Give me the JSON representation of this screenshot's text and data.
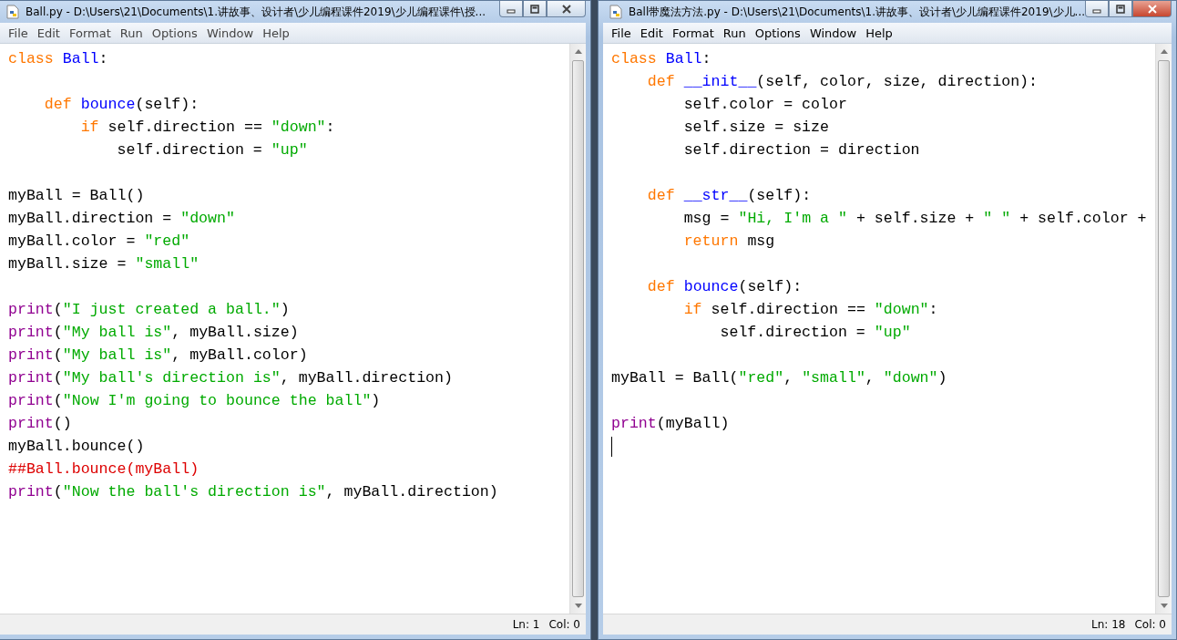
{
  "windows": [
    {
      "title": "Ball.py - D:\\Users\\21\\Documents\\1.讲故事、设计者\\少儿编程课件2019\\少儿编程课件\\授...",
      "active": false,
      "menu": [
        "File",
        "Edit",
        "Format",
        "Run",
        "Options",
        "Window",
        "Help"
      ],
      "lines": [
        {
          "kind": "code",
          "tokens": [
            {
              "kind": "keyword",
              "text": "class "
            },
            {
              "kind": "name",
              "text": "Ball"
            },
            {
              "kind": "plain",
              "text": ":"
            }
          ]
        },
        {
          "kind": "blank"
        },
        {
          "kind": "code",
          "tokens": [
            {
              "kind": "keyword",
              "text": "    def "
            },
            {
              "kind": "name",
              "text": "bounce"
            },
            {
              "kind": "plain",
              "text": "(self):"
            }
          ]
        },
        {
          "kind": "code",
          "tokens": [
            {
              "kind": "keyword",
              "text": "        if"
            },
            {
              "kind": "plain",
              "text": " self.direction == "
            },
            {
              "kind": "string",
              "text": "\"down\""
            },
            {
              "kind": "plain",
              "text": ":"
            }
          ]
        },
        {
          "kind": "code",
          "tokens": [
            {
              "kind": "plain",
              "text": "            self.direction = "
            },
            {
              "kind": "string",
              "text": "\"up\""
            }
          ]
        },
        {
          "kind": "blank"
        },
        {
          "kind": "code",
          "tokens": [
            {
              "kind": "plain",
              "text": "myBall = Ball()"
            }
          ]
        },
        {
          "kind": "code",
          "tokens": [
            {
              "kind": "plain",
              "text": "myBall.direction = "
            },
            {
              "kind": "string",
              "text": "\"down\""
            }
          ]
        },
        {
          "kind": "code",
          "tokens": [
            {
              "kind": "plain",
              "text": "myBall.color = "
            },
            {
              "kind": "string",
              "text": "\"red\""
            }
          ]
        },
        {
          "kind": "code",
          "tokens": [
            {
              "kind": "plain",
              "text": "myBall.size = "
            },
            {
              "kind": "string",
              "text": "\"small\""
            }
          ]
        },
        {
          "kind": "blank"
        },
        {
          "kind": "code",
          "tokens": [
            {
              "kind": "builtin",
              "text": "print"
            },
            {
              "kind": "plain",
              "text": "("
            },
            {
              "kind": "string",
              "text": "\"I just created a ball.\""
            },
            {
              "kind": "plain",
              "text": ")"
            }
          ]
        },
        {
          "kind": "code",
          "tokens": [
            {
              "kind": "builtin",
              "text": "print"
            },
            {
              "kind": "plain",
              "text": "("
            },
            {
              "kind": "string",
              "text": "\"My ball is\""
            },
            {
              "kind": "plain",
              "text": ", myBall.size)"
            }
          ]
        },
        {
          "kind": "code",
          "tokens": [
            {
              "kind": "builtin",
              "text": "print"
            },
            {
              "kind": "plain",
              "text": "("
            },
            {
              "kind": "string",
              "text": "\"My ball is\""
            },
            {
              "kind": "plain",
              "text": ", myBall.color)"
            }
          ]
        },
        {
          "kind": "code",
          "tokens": [
            {
              "kind": "builtin",
              "text": "print"
            },
            {
              "kind": "plain",
              "text": "("
            },
            {
              "kind": "string",
              "text": "\"My ball's direction is\""
            },
            {
              "kind": "plain",
              "text": ", myBall.direction)"
            }
          ]
        },
        {
          "kind": "code",
          "tokens": [
            {
              "kind": "builtin",
              "text": "print"
            },
            {
              "kind": "plain",
              "text": "("
            },
            {
              "kind": "string",
              "text": "\"Now I'm going to bounce the ball\""
            },
            {
              "kind": "plain",
              "text": ")"
            }
          ]
        },
        {
          "kind": "code",
          "tokens": [
            {
              "kind": "builtin",
              "text": "print"
            },
            {
              "kind": "plain",
              "text": "()"
            }
          ]
        },
        {
          "kind": "code",
          "tokens": [
            {
              "kind": "plain",
              "text": "myBall.bounce()"
            }
          ]
        },
        {
          "kind": "code",
          "tokens": [
            {
              "kind": "comment",
              "text": "##Ball.bounce(myBall)"
            }
          ]
        },
        {
          "kind": "code",
          "tokens": [
            {
              "kind": "builtin",
              "text": "print"
            },
            {
              "kind": "plain",
              "text": "("
            },
            {
              "kind": "string",
              "text": "\"Now the ball's direction is\""
            },
            {
              "kind": "plain",
              "text": ", myBall.direction)"
            }
          ]
        }
      ],
      "status": {
        "line": "Ln: 1",
        "column": "Col: 0"
      }
    },
    {
      "title": "Ball带魔法方法.py - D:\\Users\\21\\Documents\\1.讲故事、设计者\\少儿编程课件2019\\少儿...",
      "active": true,
      "menu": [
        "File",
        "Edit",
        "Format",
        "Run",
        "Options",
        "Window",
        "Help"
      ],
      "lines": [
        {
          "kind": "code",
          "tokens": [
            {
              "kind": "keyword",
              "text": "class "
            },
            {
              "kind": "name",
              "text": "Ball"
            },
            {
              "kind": "plain",
              "text": ":"
            }
          ]
        },
        {
          "kind": "code",
          "tokens": [
            {
              "kind": "keyword",
              "text": "    def "
            },
            {
              "kind": "name",
              "text": "__init__"
            },
            {
              "kind": "plain",
              "text": "(self, color, size, direction):"
            }
          ]
        },
        {
          "kind": "code",
          "tokens": [
            {
              "kind": "plain",
              "text": "        self.color = color"
            }
          ]
        },
        {
          "kind": "code",
          "tokens": [
            {
              "kind": "plain",
              "text": "        self.size = size"
            }
          ]
        },
        {
          "kind": "code",
          "tokens": [
            {
              "kind": "plain",
              "text": "        self.direction = direction"
            }
          ]
        },
        {
          "kind": "blank"
        },
        {
          "kind": "code",
          "tokens": [
            {
              "kind": "keyword",
              "text": "    def "
            },
            {
              "kind": "name",
              "text": "__str__"
            },
            {
              "kind": "plain",
              "text": "(self):"
            }
          ]
        },
        {
          "kind": "code",
          "tokens": [
            {
              "kind": "plain",
              "text": "        msg = "
            },
            {
              "kind": "string",
              "text": "\"Hi, I'm a \""
            },
            {
              "kind": "plain",
              "text": " + self.size + "
            },
            {
              "kind": "string",
              "text": "\" \""
            },
            {
              "kind": "plain",
              "text": " + self.color +"
            }
          ]
        },
        {
          "kind": "code",
          "tokens": [
            {
              "kind": "keyword",
              "text": "        return"
            },
            {
              "kind": "plain",
              "text": " msg"
            }
          ]
        },
        {
          "kind": "blank"
        },
        {
          "kind": "code",
          "tokens": [
            {
              "kind": "keyword",
              "text": "    def "
            },
            {
              "kind": "name",
              "text": "bounce"
            },
            {
              "kind": "plain",
              "text": "(self):"
            }
          ]
        },
        {
          "kind": "code",
          "tokens": [
            {
              "kind": "keyword",
              "text": "        if"
            },
            {
              "kind": "plain",
              "text": " self.direction == "
            },
            {
              "kind": "string",
              "text": "\"down\""
            },
            {
              "kind": "plain",
              "text": ":"
            }
          ]
        },
        {
          "kind": "code",
          "tokens": [
            {
              "kind": "plain",
              "text": "            self.direction = "
            },
            {
              "kind": "string",
              "text": "\"up\""
            }
          ]
        },
        {
          "kind": "blank"
        },
        {
          "kind": "code",
          "tokens": [
            {
              "kind": "plain",
              "text": "myBall = Ball("
            },
            {
              "kind": "string",
              "text": "\"red\""
            },
            {
              "kind": "plain",
              "text": ", "
            },
            {
              "kind": "string",
              "text": "\"small\""
            },
            {
              "kind": "plain",
              "text": ", "
            },
            {
              "kind": "string",
              "text": "\"down\""
            },
            {
              "kind": "plain",
              "text": ")"
            }
          ]
        },
        {
          "kind": "blank"
        },
        {
          "kind": "code",
          "tokens": [
            {
              "kind": "builtin",
              "text": "print"
            },
            {
              "kind": "plain",
              "text": "(myBall)"
            }
          ]
        },
        {
          "kind": "cursor"
        }
      ],
      "status": {
        "line": "Ln: 18",
        "column": "Col: 0"
      }
    }
  ]
}
